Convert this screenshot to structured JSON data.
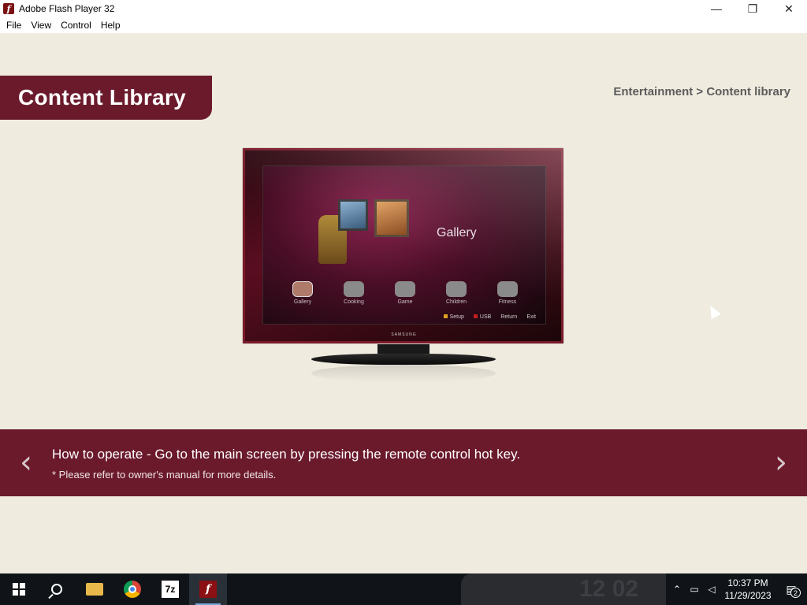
{
  "window": {
    "title": "Adobe Flash Player 32",
    "app_icon": "flash-icon",
    "minimize": "—",
    "restore": "❐",
    "close": "✕"
  },
  "menu": {
    "items": [
      "File",
      "View",
      "Control",
      "Help"
    ]
  },
  "page": {
    "title": "Content Library",
    "breadcrumb": "Entertainment > Content library",
    "accent_color": "#6b1a2c"
  },
  "tv": {
    "screen_title": "Gallery",
    "brand": "SAMSUNG",
    "menu_icons": [
      {
        "label": "Gallery",
        "active": true
      },
      {
        "label": "Cooking",
        "active": false
      },
      {
        "label": "Game",
        "active": false
      },
      {
        "label": "Children",
        "active": false
      },
      {
        "label": "Fitness",
        "active": false
      }
    ],
    "bottom_menu": [
      {
        "label": "Setup",
        "color": "#e0a020"
      },
      {
        "label": "USB",
        "color": "#c02020"
      },
      {
        "label": "Return",
        "color": "#cccccc"
      },
      {
        "label": "Exit",
        "color": "#cccccc"
      }
    ]
  },
  "instructions": {
    "main": "How to operate - Go to the main screen by pressing the remote control hot key.",
    "note": "* Please refer to owner's manual for more details.",
    "prev_arrow": "‹",
    "next_arrow": "›"
  },
  "taskbar": {
    "apps": [
      "start-icon",
      "search-icon",
      "file-explorer-icon",
      "chrome-icon",
      "7zip-icon",
      "flash-player-icon"
    ],
    "sevenzip_label": "7z",
    "flash_label": "f",
    "clock_time": "10:37 PM",
    "clock_date": "11/29/2023",
    "notification_count": "2",
    "wallpaper_text": "12 02"
  }
}
